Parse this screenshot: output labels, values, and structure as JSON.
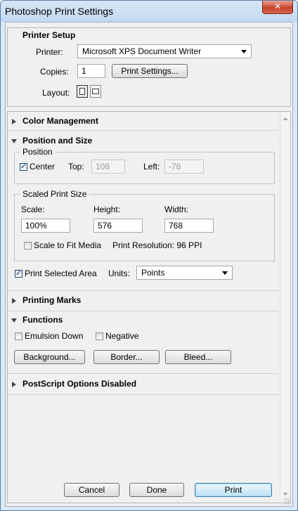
{
  "window": {
    "title": "Photoshop Print Settings",
    "close_glyph": "✕"
  },
  "printer_setup": {
    "title": "Printer Setup",
    "printer_label": "Printer:",
    "printer_value": "Microsoft XPS Document Writer",
    "copies_label": "Copies:",
    "copies_value": "1",
    "print_settings_button": "Print Settings...",
    "layout_label": "Layout:",
    "layout_options": [
      "portrait-icon",
      "landscape-icon"
    ],
    "layout_selected": "portrait-icon"
  },
  "sections": {
    "color_management": "Color Management",
    "position_and_size": "Position and Size",
    "printing_marks": "Printing Marks",
    "functions": "Functions",
    "postscript": "PostScript Options Disabled"
  },
  "position": {
    "legend": "Position",
    "center_label": "Center",
    "center_checked": true,
    "top_label": "Top:",
    "top_value": "108",
    "left_label": "Left:",
    "left_value": "-78"
  },
  "scaled_print_size": {
    "legend": "Scaled Print Size",
    "scale_label": "Scale:",
    "scale_value": "100%",
    "height_label": "Height:",
    "height_value": "576",
    "width_label": "Width:",
    "width_value": "768",
    "scale_to_fit_label": "Scale to Fit Media",
    "scale_to_fit_checked": false,
    "resolution_text": "Print Resolution: 96 PPI"
  },
  "print_selected": {
    "label": "Print Selected Area",
    "checked": true,
    "units_label": "Units:",
    "units_value": "Points"
  },
  "functions": {
    "emulsion_down_label": "Emulsion Down",
    "emulsion_down_checked": false,
    "negative_label": "Negative",
    "negative_checked": false,
    "background_button": "Background...",
    "border_button": "Border...",
    "bleed_button": "Bleed..."
  },
  "footer": {
    "cancel": "Cancel",
    "done": "Done",
    "print": "Print"
  },
  "glyphs": {
    "check": "✓"
  }
}
